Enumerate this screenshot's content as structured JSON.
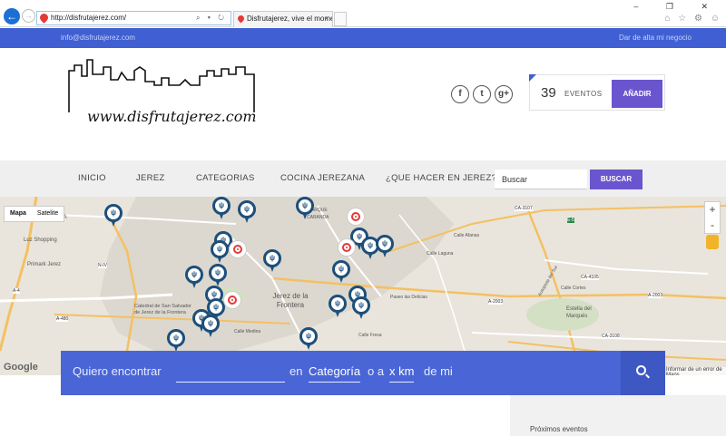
{
  "browser": {
    "url": "http://disfrutajerez.com/",
    "tab_title": "Disfrutajerez, vive el mome...",
    "tab_close": "×",
    "address_tools": "⌕ ▾ ↻",
    "window_controls": "–  ❐  ✕",
    "toolbar_icons": "⌂ ☆ ⚙ ☺"
  },
  "topstrip": {
    "email": "info@disfrutajerez.com",
    "signup": "Dar de alta mi negocio"
  },
  "header": {
    "logo_text": "www.disfrutajerez.com",
    "social": [
      "f",
      "t",
      "g+"
    ],
    "event_count": "39",
    "event_label": "EVENTOS",
    "add_label": "AÑADIR"
  },
  "nav": {
    "items": [
      "INICIO",
      "JEREZ",
      "CATEGORIAS",
      "COCINA JEREZANA",
      "¿QUE HACER EN JEREZ?"
    ],
    "search_placeholder": "Buscar",
    "search_button": "BUSCAR"
  },
  "map": {
    "type_map": "Mapa",
    "type_satellite": "Satelite",
    "zoom_in": "+",
    "zoom_out": "-",
    "error_text": "Informar de un error de Maps",
    "google": "Google",
    "labels": {
      "ikea": "IKEA",
      "luz_shopping": "Luz Shopping",
      "primark": "Primark Jerez",
      "n_iv": "N-IV",
      "a4": "A-4",
      "a480": "A-480",
      "jerez_center": "Jerez de la Frontera",
      "catedral": "Catedral de San Salvador de Jerez de la Frontera",
      "parque": "PARQUE",
      "caranda": "CARANDA",
      "calle_afanas": "Calle Afanas",
      "calle_laguna": "Calle Laguna",
      "delicias": "Paseo las Delicias",
      "ca3107": "CA-3107",
      "e5": "E-5",
      "ca4105": "CA-4105",
      "a2003": "A-2003",
      "ca3108": "CA-3108",
      "estella": "Estella del Marqués",
      "cortes": "Calle Cortes",
      "autopista": "Autopista del Sur",
      "medina": "Calle Medina",
      "fresa": "Calle Fresa"
    }
  },
  "finder": {
    "prefix": "Quiero encontrar",
    "in_word": "en",
    "category": "Categoría",
    "or_word": "o a",
    "distance": "x km",
    "suffix": "de mi"
  },
  "sidebar": {
    "upcoming_label": "Próximos eventos"
  },
  "colors": {
    "brand_blue": "#3f5fd3",
    "purple": "#6b55cf",
    "pin_blue": "#1d4f7a",
    "pin_red": "#e53935"
  }
}
